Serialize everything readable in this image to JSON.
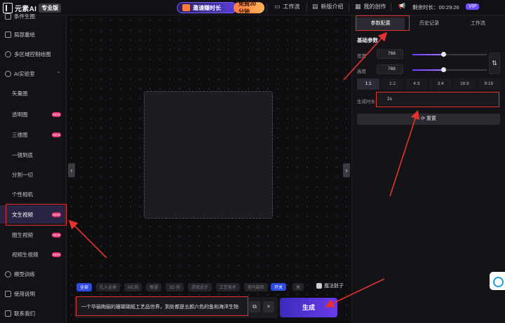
{
  "app": {
    "logo_text": "元素AI",
    "edition_badge": "专业版"
  },
  "header": {
    "invite": "邀请赚时长",
    "free_trial": "免费30分钟",
    "workbench": "工作流",
    "new_release": "新版介绍",
    "my_works": "我的创作",
    "remaining": "剩余时长：00:29:26",
    "vip": "VIP"
  },
  "sidebar": {
    "items": [
      {
        "label": "条件生图",
        "badge": ""
      },
      {
        "label": "局部重绘",
        "badge": ""
      },
      {
        "label": "多区域控制绘图",
        "badge": ""
      },
      {
        "label": "AI实验室",
        "badge": ""
      },
      {
        "label": "矢量图",
        "badge": ""
      },
      {
        "label": "透明图",
        "badge": "NEW"
      },
      {
        "label": "三维图",
        "badge": "NEW"
      },
      {
        "label": "一镜到底",
        "badge": ""
      },
      {
        "label": "分割一切",
        "badge": ""
      },
      {
        "label": "个性相机",
        "badge": ""
      },
      {
        "label": "文生视频",
        "badge": "NEW"
      },
      {
        "label": "图生视频",
        "badge": "NEW"
      },
      {
        "label": "视频生视频",
        "badge": "NEW"
      },
      {
        "label": "模型训练",
        "badge": ""
      },
      {
        "label": "使用说明",
        "badge": ""
      },
      {
        "label": "联系我们",
        "badge": ""
      }
    ]
  },
  "canvas": {
    "chips": [
      "全部",
      "扎入全景",
      "MC风",
      "图漫",
      "3D 风",
      "游戏设计",
      "工艺美术",
      "室内装修"
    ],
    "toggle_on": "开关",
    "toggle_off": "关",
    "magic_dice": "魔法骰子",
    "prompt": "一个华丽绚丽的珊瑚瑚纸工艺品世界，到处都是五颜六色的鱼和海洋生物",
    "generate": "生成"
  },
  "panel": {
    "tabs": [
      "参数配置",
      "历史记录",
      "工作流"
    ],
    "section_title": "基础参数",
    "width_label": "宽度",
    "width_value": "768",
    "height_label": "高度",
    "height_value": "768",
    "width_slider": 0.42,
    "height_slider": 0.42,
    "ratios": [
      "1:1",
      "1:2",
      "4:3",
      "3:4",
      "16:9",
      "9:16"
    ],
    "duration_label": "生成时长",
    "duration_value": "2s",
    "reset": "重置"
  },
  "colors": {
    "accent": "#6c4cff",
    "highlight": "#e6322e",
    "new_badge": "#e2326f"
  }
}
